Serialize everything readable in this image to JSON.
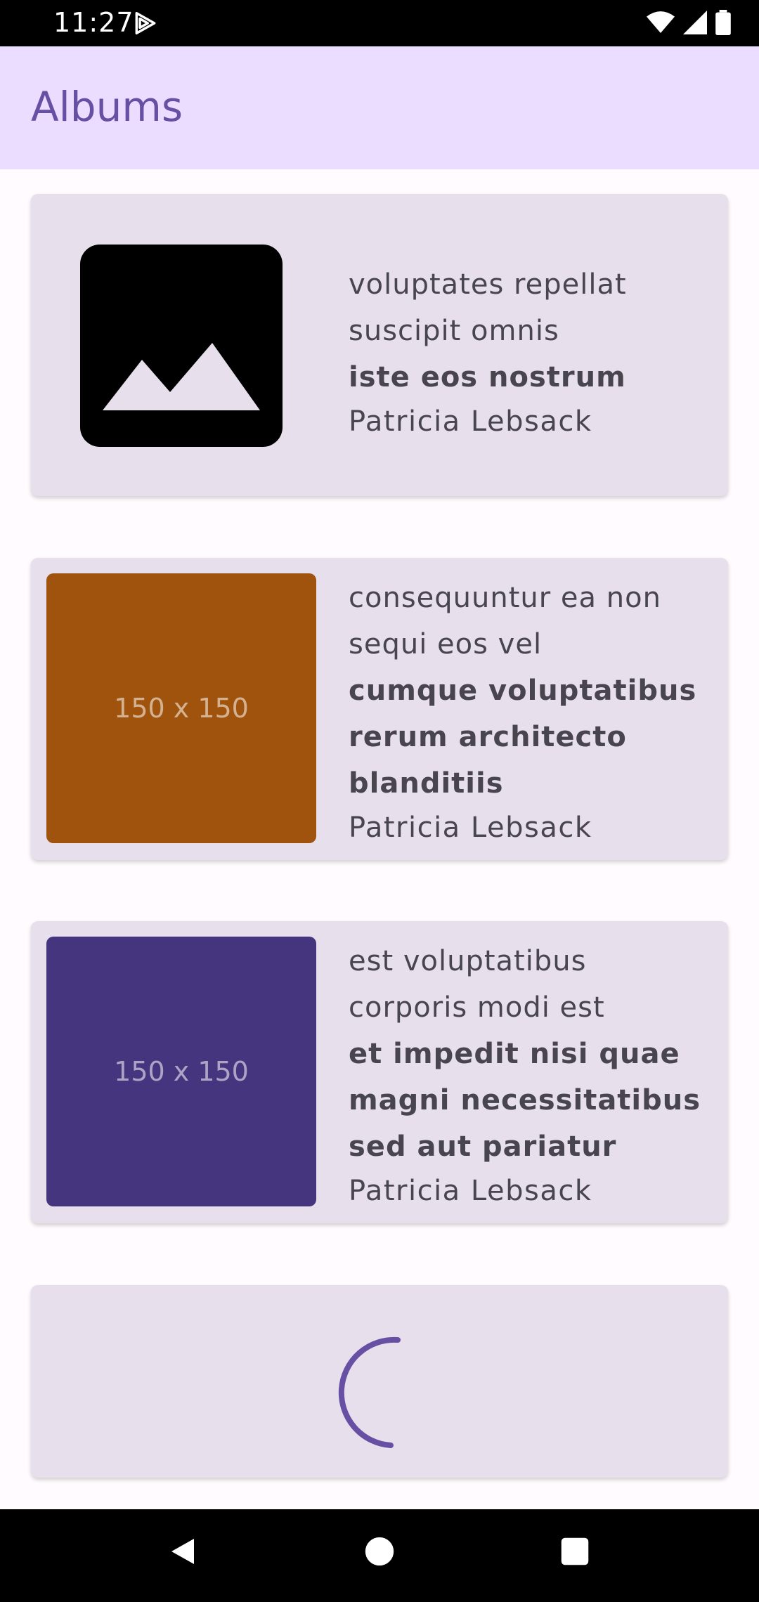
{
  "status_bar": {
    "time": "11:27"
  },
  "app_bar": {
    "title": "Albums"
  },
  "albums": [
    {
      "title": "voluptates repellat suscipit omnis",
      "subtitle": "iste eos nostrum",
      "author": "Patricia Lebsack",
      "thumbnail": {
        "icon": "image-placeholder-icon"
      }
    },
    {
      "title": "consequuntur ea non sequi eos vel",
      "subtitle": "cumque voluptatibus rerum architecto blanditiis",
      "author": "Patricia Lebsack",
      "thumbnail": {
        "label": "150 x 150",
        "color": "#a0530c"
      }
    },
    {
      "title": "est voluptatibus corporis modi est",
      "subtitle": "et impedit nisi quae magni necessitatibus sed aut pariatur",
      "author": "Patricia Lebsack",
      "thumbnail": {
        "label": "150 x 150",
        "color": "#45357f"
      }
    }
  ],
  "loading": {
    "spinner_color": "#6750a4"
  },
  "nav": {
    "back": "back-icon",
    "home": "home-icon",
    "recents": "recents-icon"
  }
}
